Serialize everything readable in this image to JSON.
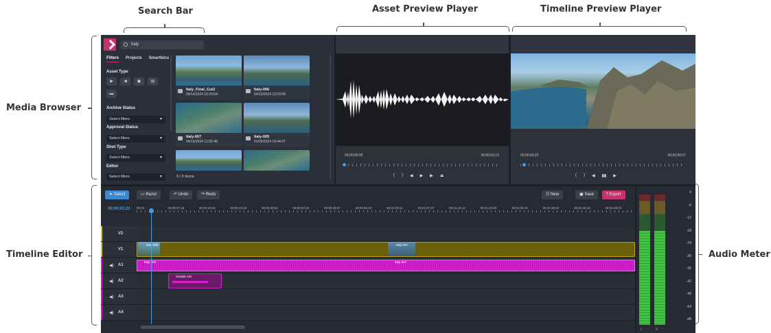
{
  "annotations": {
    "search_bar": "Search Bar",
    "asset_preview": "Asset Preview Player",
    "timeline_preview": "Timeline Preview Player",
    "media_browser": "Media Browser",
    "timeline_editor": "Timeline Editor",
    "audio_meter": "Audio Meter"
  },
  "browser": {
    "search_value": "Italy",
    "tabs": [
      "Filters",
      "Projects",
      "Smartbins"
    ],
    "filters": {
      "asset_type_label": "Asset Type",
      "archive_status_label": "Archive Status",
      "approval_status_label": "Approval Status",
      "shot_type_label": "Shot Type",
      "editor_label": "Editor",
      "select_placeholder": "Select filters"
    },
    "assets": [
      {
        "name": "Italy_Final_Cut2",
        "date": "06/14/2024 10:29:54"
      },
      {
        "name": "Italy-006",
        "date": "04/15/2024 12:03:08"
      },
      {
        "name": "Italy-007",
        "date": "04/15/2024 12:02:48"
      },
      {
        "name": "Italy-005",
        "date": "01/09/2024 10:44:07"
      }
    ],
    "item_count": "9 / 9 Items"
  },
  "asset_player": {
    "start_tc": "00;00;00;00",
    "end_tc": "00;00;03;12"
  },
  "timeline_player": {
    "start_tc": "00;00;03;23",
    "end_tc": "00;02;00;07"
  },
  "editor": {
    "toolbar": {
      "select": "Select",
      "razor": "Razor",
      "undo": "Undo",
      "redo": "Redo",
      "new": "New",
      "save": "Save",
      "export": "Export"
    },
    "timecode": "00;00;03;23",
    "ruler": [
      "00;00",
      "00;00;07;16",
      "00;00;15;02",
      "00;00;22;18",
      "00;00;30;04",
      "00;00;37;20",
      "00;00;45;07",
      "00;00;52;23",
      "00;01;00;11",
      "00;01;07;27",
      "00;01;15;13",
      "00;01;22;29",
      "00;01;30;16",
      "00;01;38;02",
      "00;01;45;18",
      "00;01;53;04",
      "00;0"
    ],
    "tracks": [
      "V2",
      "V1",
      "A1",
      "A2",
      "A3",
      "A4"
    ],
    "clips": {
      "v1_a": "Italy-006",
      "v1_b": "Italy-007",
      "a1_a": "Italy-006",
      "a1_b": "Italy-007",
      "a2_a": "sample-12s"
    }
  },
  "meter": {
    "scale": [
      "0",
      "-6",
      "-12",
      "-18",
      "-24",
      "-30",
      "-36",
      "-42",
      "-48",
      "-54",
      "dB"
    ],
    "channels": [
      "L",
      "R"
    ],
    "level_fraction": 0.72
  }
}
